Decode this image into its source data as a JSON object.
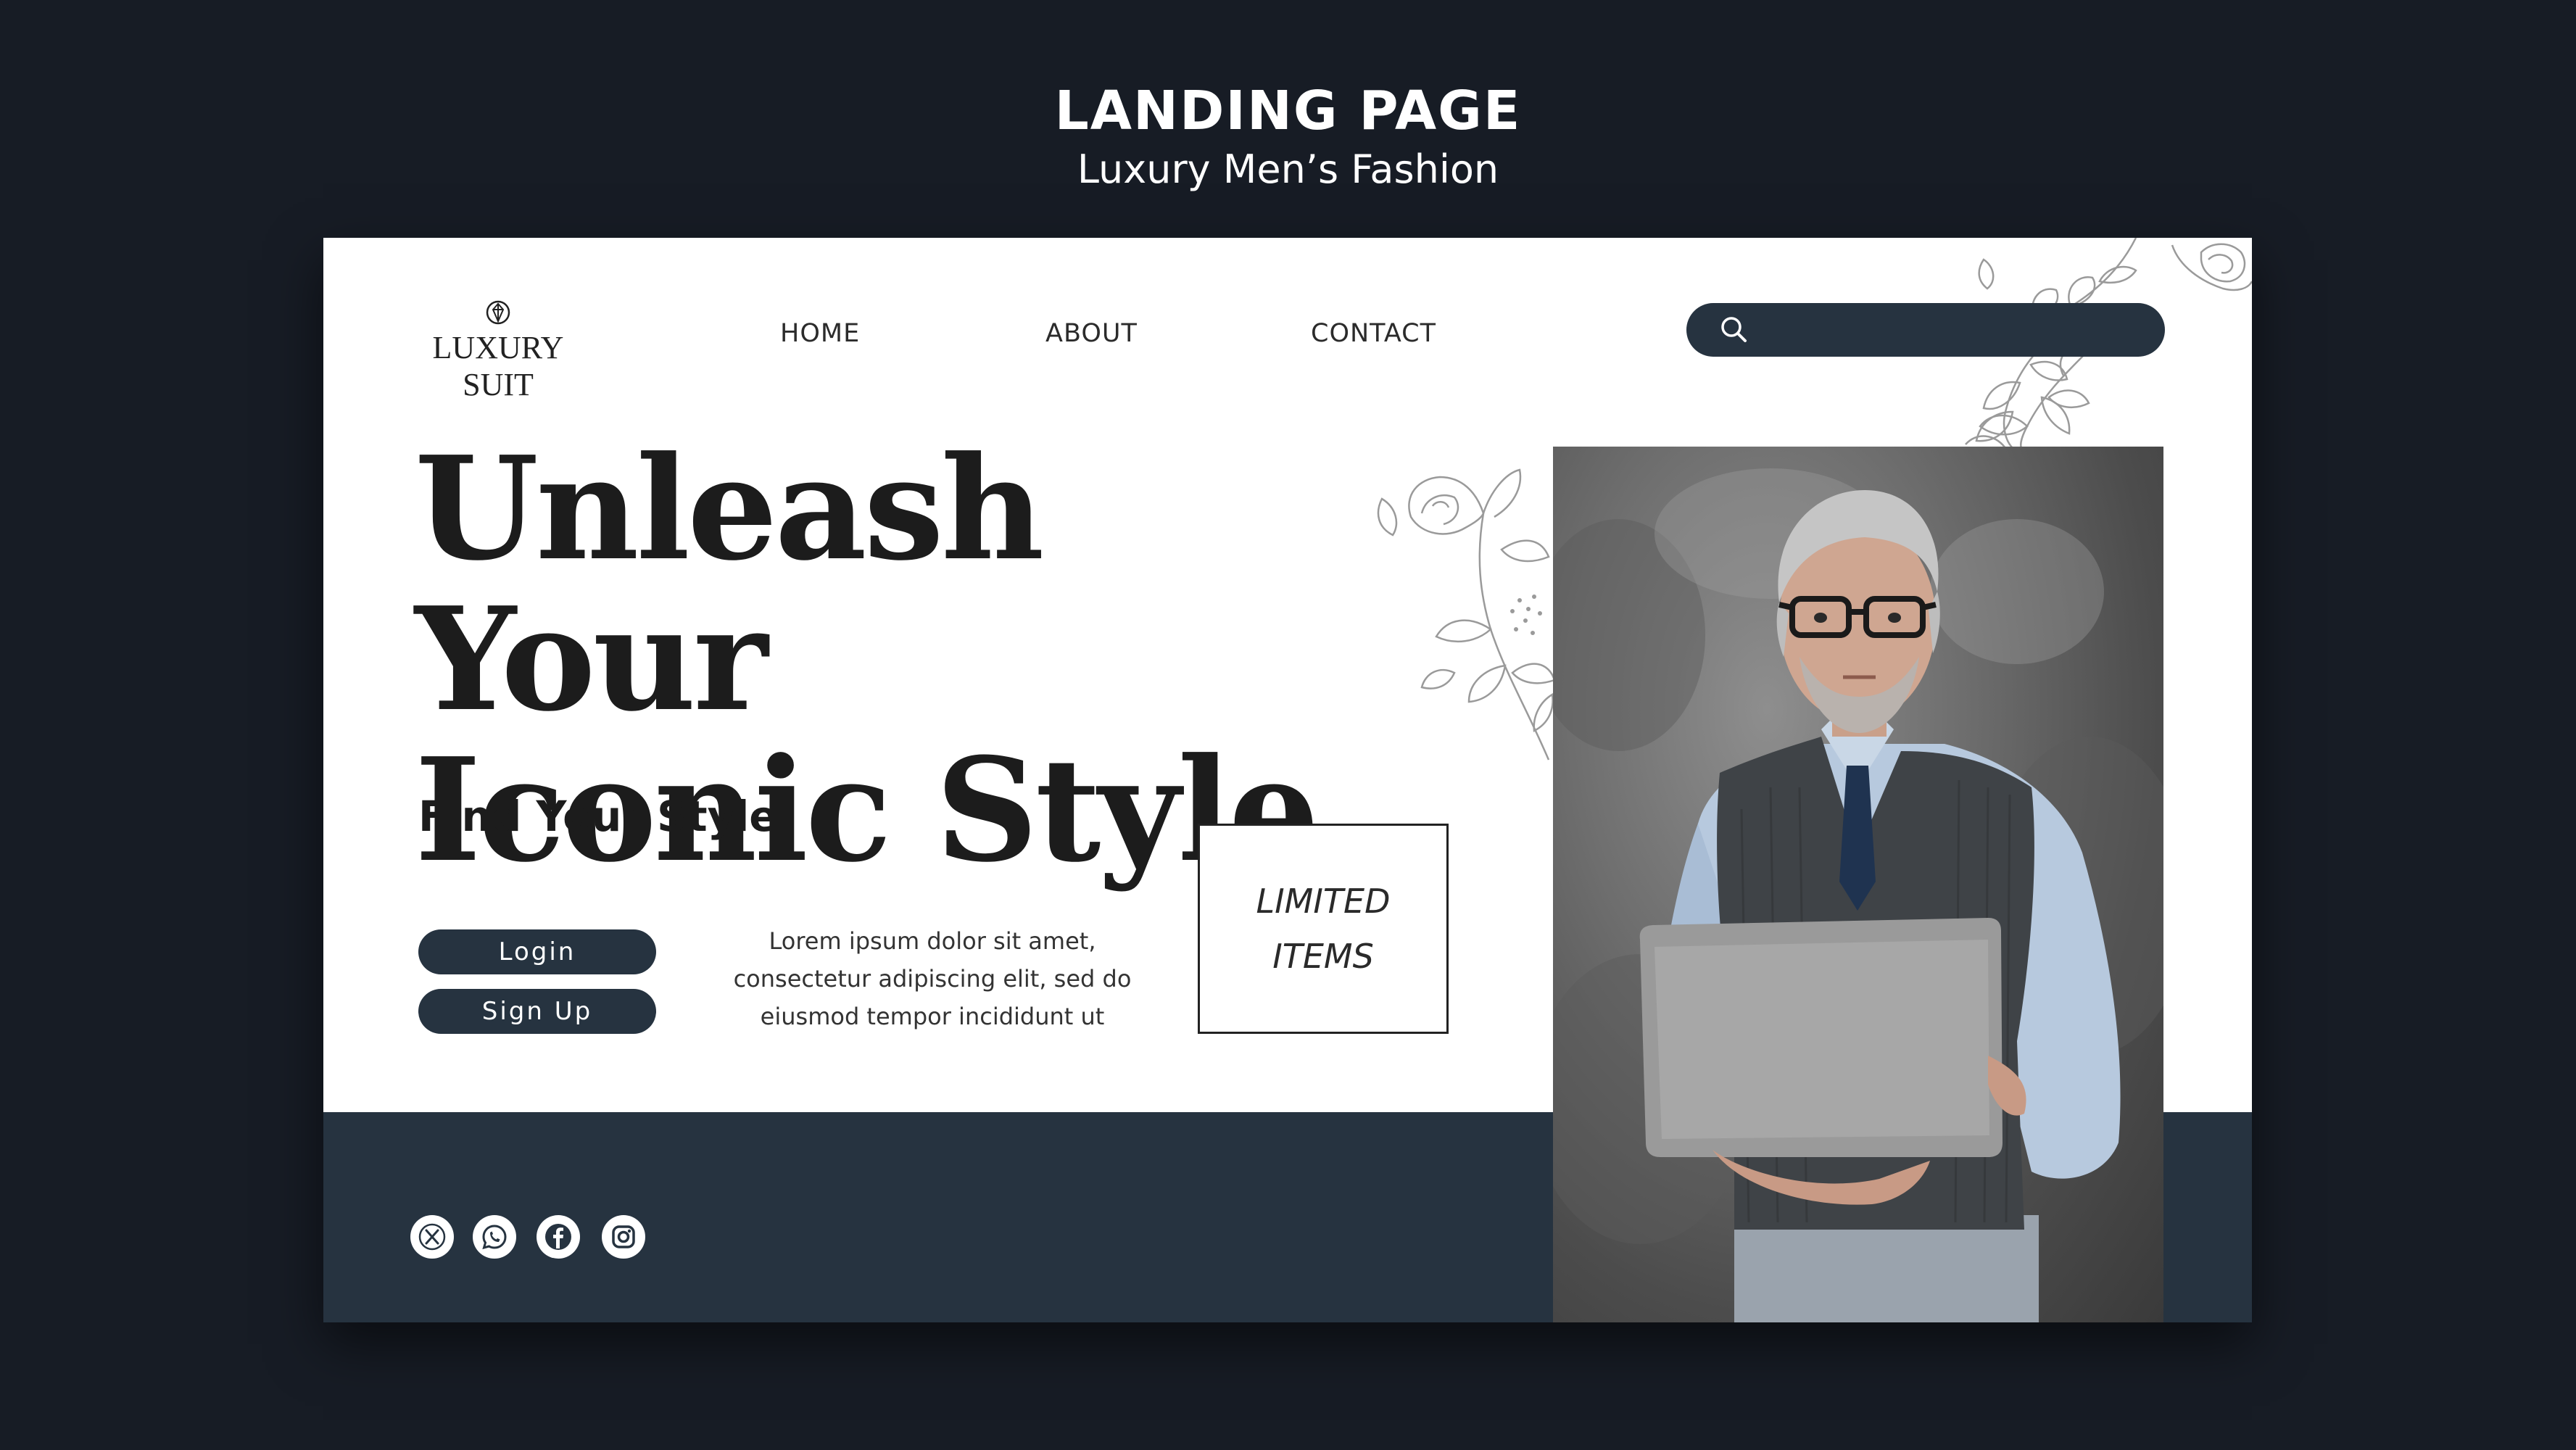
{
  "header": {
    "title": "LANDING PAGE",
    "subtitle": "Luxury Men’s Fashion"
  },
  "site": {
    "logo_text": "LUXURY SUIT",
    "logo_icon": "diamond-icon"
  },
  "nav": {
    "items": [
      {
        "label": "HOME"
      },
      {
        "label": "ABOUT"
      },
      {
        "label": "CONTACT"
      }
    ]
  },
  "search": {
    "icon": "search-icon",
    "placeholder": ""
  },
  "hero": {
    "title_line1": "Unleash Your",
    "title_line2": "Iconic Style",
    "subtitle": "Find Your Style",
    "body_line1": "Lorem ipsum dolor sit amet,",
    "body_line2": "consectetur adipiscing elit, sed do",
    "body_line3": "eiusmod tempor incididunt ut"
  },
  "buttons": {
    "login": "Login",
    "signup": "Sign Up"
  },
  "badge": {
    "line1": "LIMITED",
    "line2": "ITEMS"
  },
  "social": [
    {
      "icon": "x-twitter-icon"
    },
    {
      "icon": "whatsapp-icon"
    },
    {
      "icon": "facebook-icon"
    },
    {
      "icon": "instagram-icon"
    }
  ],
  "colors": {
    "page_background": "#171c25",
    "accent_dark": "#263340",
    "card_background": "#ffffff",
    "text_dark": "#1c1c1c"
  }
}
